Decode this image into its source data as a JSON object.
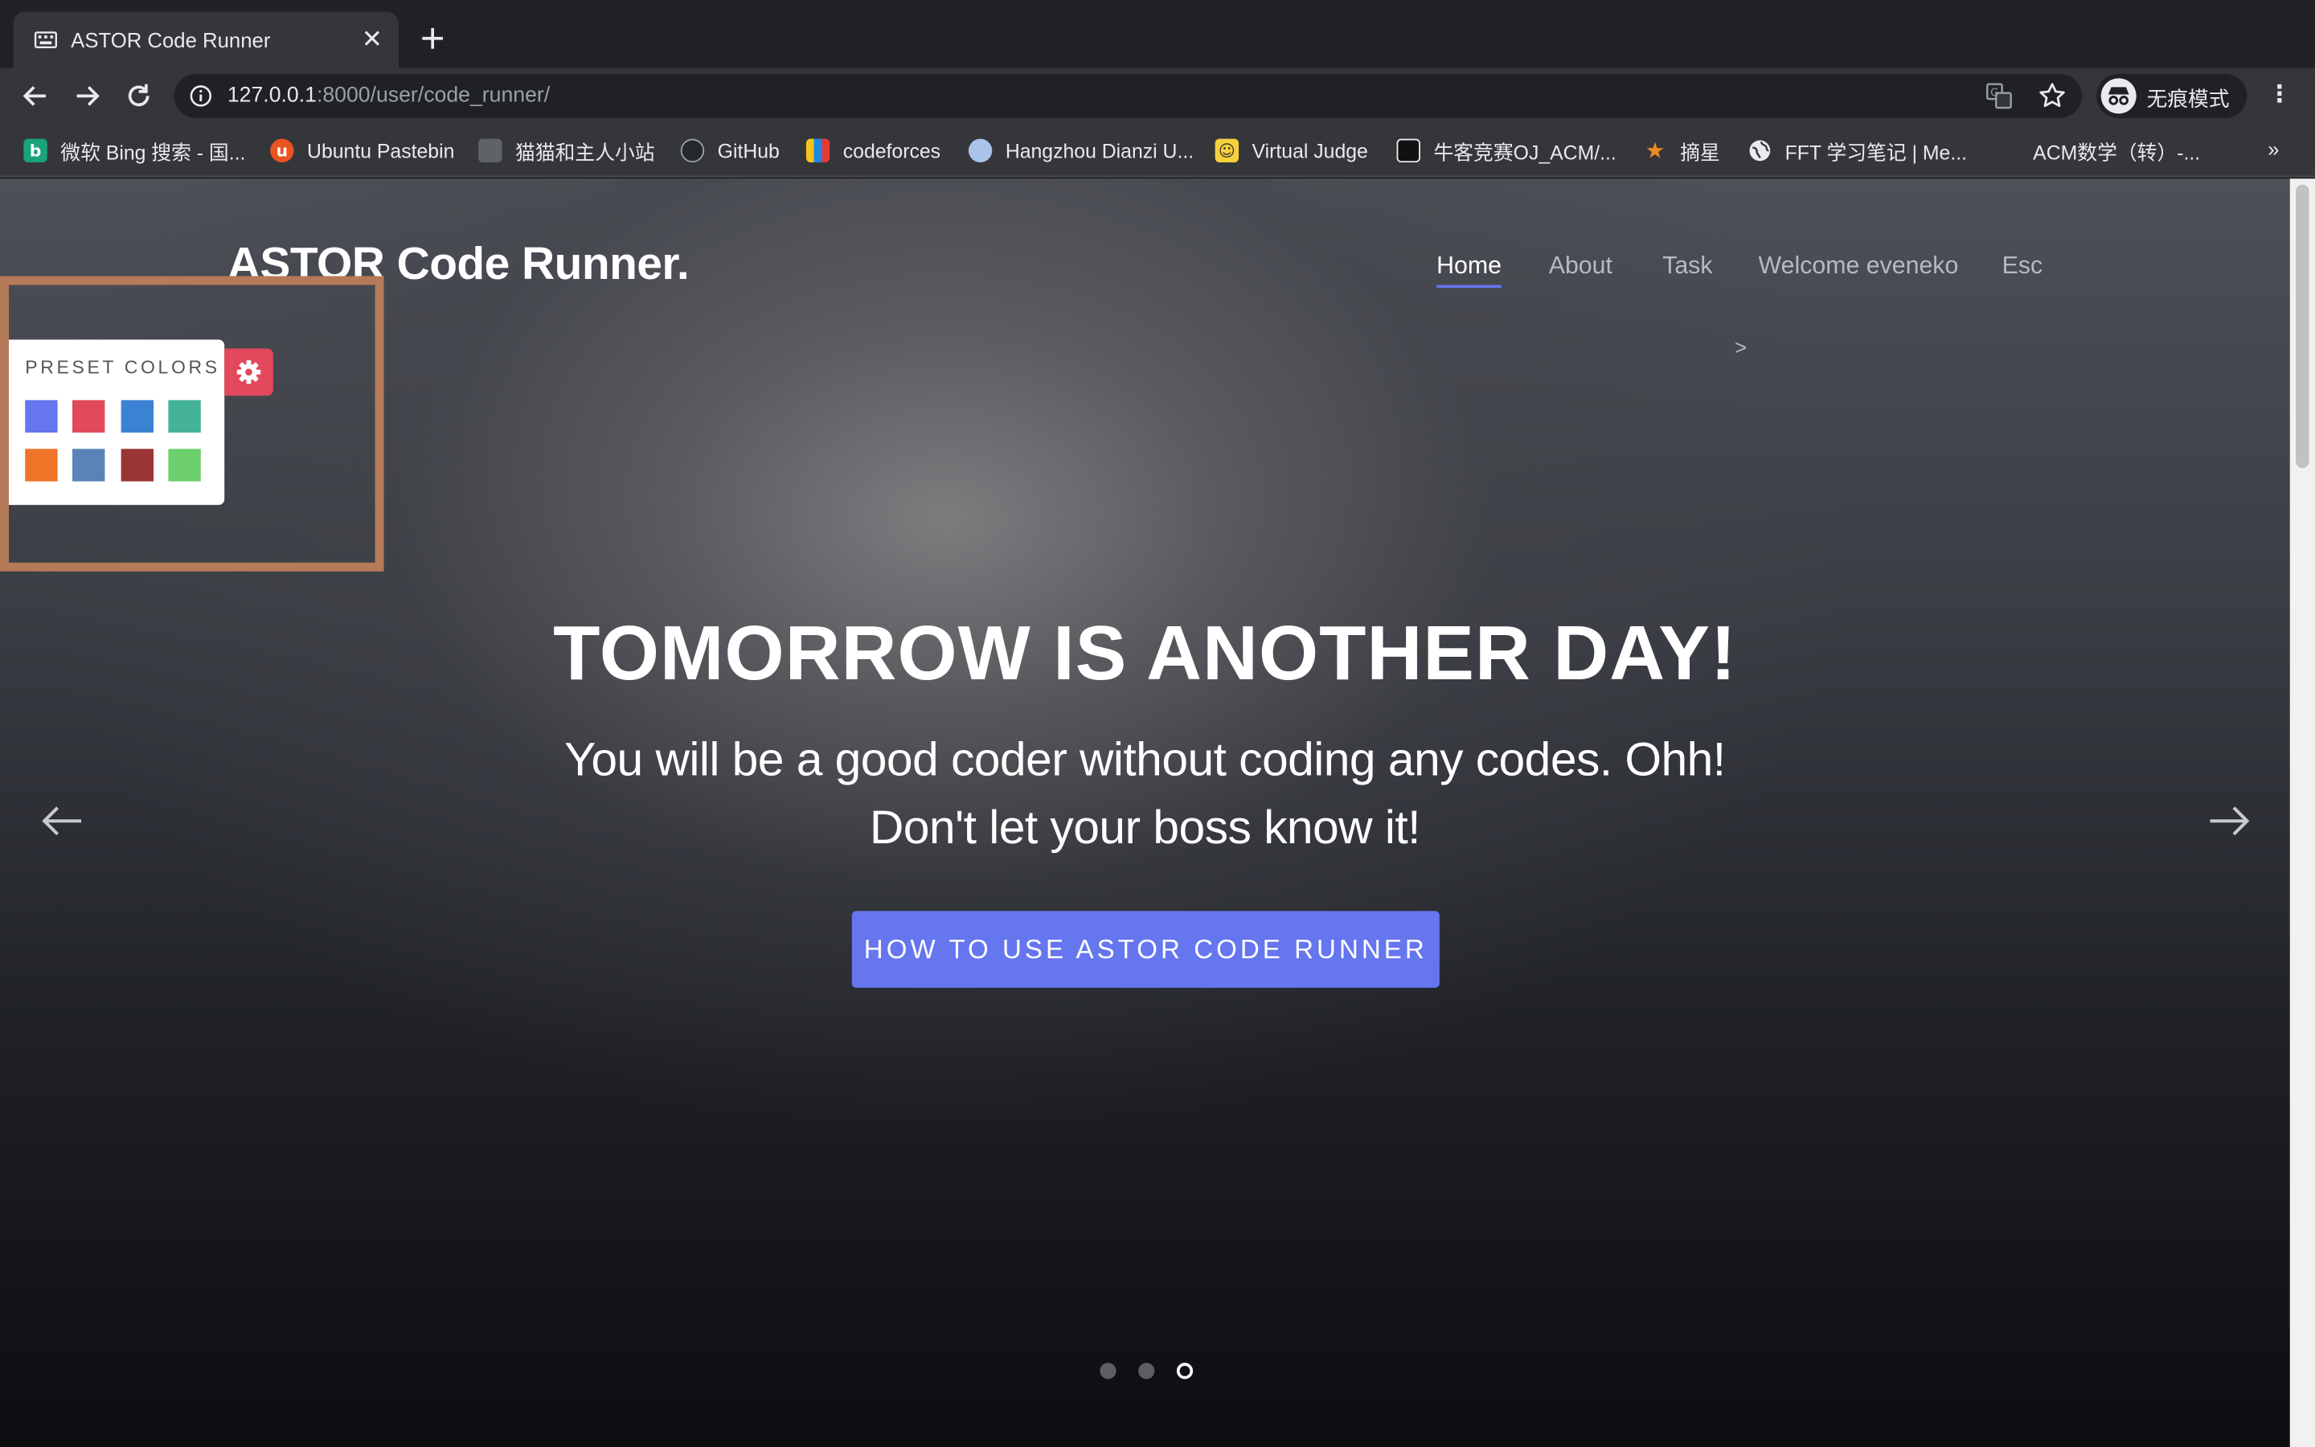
{
  "browser": {
    "tab": {
      "title": "ASTOR Code Runner",
      "close": "✕"
    },
    "url": {
      "host": "127.0.0.1",
      "rest": ":8000/user/code_runner/"
    },
    "profile_label": "无痕模式",
    "bookmarks": [
      {
        "label": "微软 Bing 搜索 - 国...",
        "icon": "bing-icon",
        "color": "#1aa37a",
        "glyph": "b"
      },
      {
        "label": "Ubuntu Pastebin",
        "icon": "ubuntu-icon",
        "color": "#e95420",
        "glyph": "u"
      },
      {
        "label": "猫猫和主人小站",
        "icon": "cat-icon",
        "color": "#5f6368",
        "glyph": ""
      },
      {
        "label": "GitHub",
        "icon": "github-icon",
        "color": "#24292e",
        "glyph": ""
      },
      {
        "label": "codeforces",
        "icon": "codeforces-icon",
        "color": "#f2f2f2",
        "glyph": ""
      },
      {
        "label": "Hangzhou Dianzi U...",
        "icon": "hdu-icon",
        "color": "#a9c4e8",
        "glyph": ""
      },
      {
        "label": "Virtual Judge",
        "icon": "vjudge-icon",
        "color": "#f5d13b",
        "glyph": "☺"
      },
      {
        "label": "牛客竞赛OJ_ACM/...",
        "icon": "nowcoder-icon",
        "color": "#111111",
        "glyph": ""
      },
      {
        "label": "摘星",
        "icon": "star-bookmark-icon",
        "color": "#35363a",
        "glyph": "★"
      },
      {
        "label": "FFT 学习笔记 | Me...",
        "icon": "globe-icon",
        "color": "#35363a",
        "glyph": ""
      },
      {
        "label": "ACM数学（转）-...",
        "icon": "blank-page-icon",
        "color": "#35363a",
        "glyph": ""
      }
    ],
    "bookmarks_more": "»"
  },
  "site": {
    "brand": "ASTOR Code Runner.",
    "nav": [
      "Home",
      "About",
      "Task",
      "Welcome eveneko",
      "Esc"
    ],
    "nav_chevron": ">"
  },
  "hero": {
    "title": "TOMORROW IS ANOTHER DAY!",
    "line1": "You will be a good coder without coding any codes. Ohh!",
    "line2": "Don't let your boss know it!",
    "cta": "HOW TO USE ASTOR CODE RUNNER",
    "slide_count": 3,
    "active_slide": 3
  },
  "preset_panel": {
    "label": "PRESET COLORS",
    "colors": [
      "#6576ee",
      "#e24a5c",
      "#3b82d4",
      "#44b39a",
      "#ee7428",
      "#5a84b8",
      "#9b3434",
      "#6ecf6e"
    ]
  }
}
